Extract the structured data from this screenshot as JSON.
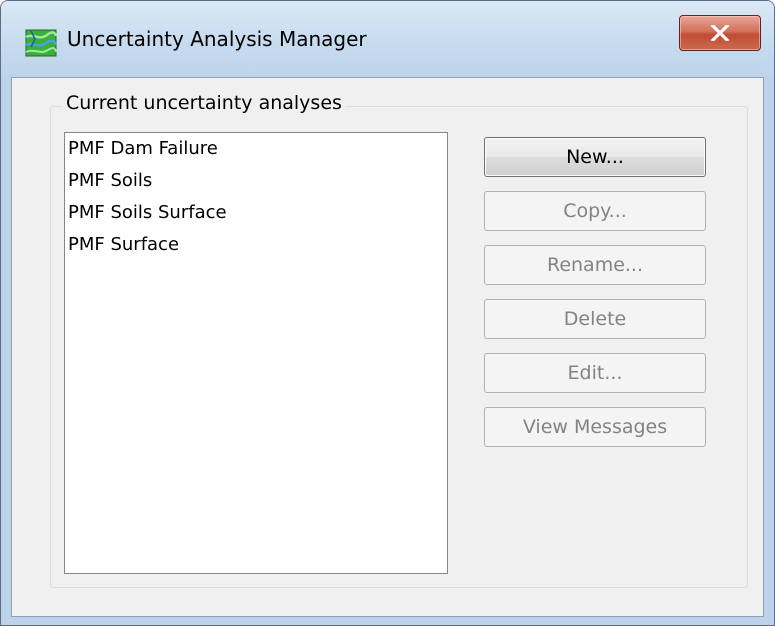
{
  "window": {
    "title": "Uncertainty Analysis Manager",
    "app_icon": "watershed-map-icon",
    "close_icon": "close-x-icon"
  },
  "group": {
    "label": "Current uncertainty analyses"
  },
  "analyses": [
    "PMF Dam Failure",
    "PMF Soils",
    "PMF Soils Surface",
    "PMF Surface"
  ],
  "buttons": {
    "new": {
      "label": "New...",
      "enabled": true
    },
    "copy": {
      "label": "Copy...",
      "enabled": false
    },
    "rename": {
      "label": "Rename...",
      "enabled": false
    },
    "delete": {
      "label": "Delete",
      "enabled": false
    },
    "edit": {
      "label": "Edit...",
      "enabled": false
    },
    "view_messages": {
      "label": "View Messages",
      "enabled": false
    }
  },
  "colors": {
    "titlebar": "#c7dbef",
    "close_button": "#c14c34",
    "dialog_bg": "#f0f0f0",
    "disabled_text": "#838383"
  }
}
